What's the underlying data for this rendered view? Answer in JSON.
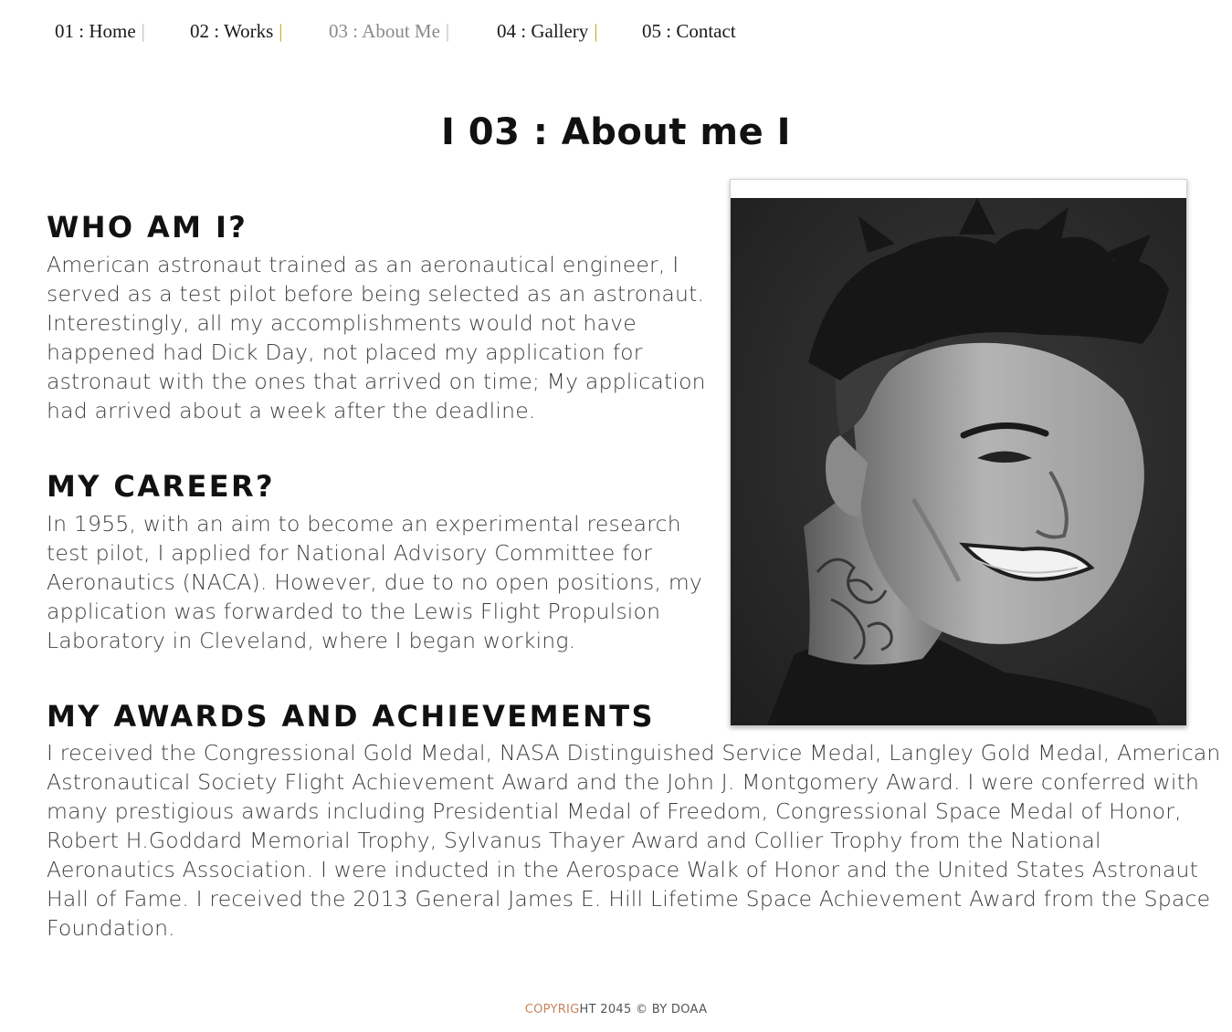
{
  "nav": {
    "items": [
      {
        "label": "01 : Home",
        "active": false
      },
      {
        "label": "02 : Works",
        "active": false
      },
      {
        "label": "03 : About Me",
        "active": true
      },
      {
        "label": "04 : Gallery",
        "active": false
      },
      {
        "label": "05 : Contact",
        "active": false
      }
    ],
    "separator": "|"
  },
  "page_title": "I 03 : About me I",
  "sections": {
    "who": {
      "heading": "WHO AM I?",
      "text": "American astronaut trained as an aeronautical engineer, I served as a test pilot before being selected as an astronaut. Interestingly, all my accomplishments would not have happened had Dick Day, not placed my application for astronaut with the ones that arrived on time; My application had arrived about a week after the deadline."
    },
    "career": {
      "heading": "MY CAREER?",
      "text": "In 1955, with an aim to become an experimental research test pilot, I applied for National Advisory Committee for Aeronautics (NACA). However, due to no open positions, my application was forwarded to the Lewis Flight Propulsion Laboratory in Cleveland, where I began working."
    },
    "awards": {
      "heading": "MY AWARDS AND ACHIEVEMENTS",
      "text": "I received the Congressional Gold Medal, NASA Distinguished Service Medal, Langley Gold Medal, American Astronautical Society Flight Achievement Award and the John J. Montgomery Award. I were conferred with many prestigious awards including Presidential Medal of Freedom, Congressional Space Medal of Honor, Robert H.Goddard Memorial Trophy, Sylvanus Thayer Award and Collier Trophy from the National Aeronautics Association. I were inducted in the Aerospace Walk of Honor and the United States Astronaut Hall of Fame. I received the 2013 General James E. Hill Lifetime Space Achievement Award from the Space Foundation."
    }
  },
  "footer": {
    "accent_part": "COPYRIG",
    "rest": "HT 2045 © BY DOAA"
  },
  "colors": {
    "accent": "#c8845a",
    "nav_active": "#8a8a8a",
    "separator_gold": "#c9a227"
  }
}
